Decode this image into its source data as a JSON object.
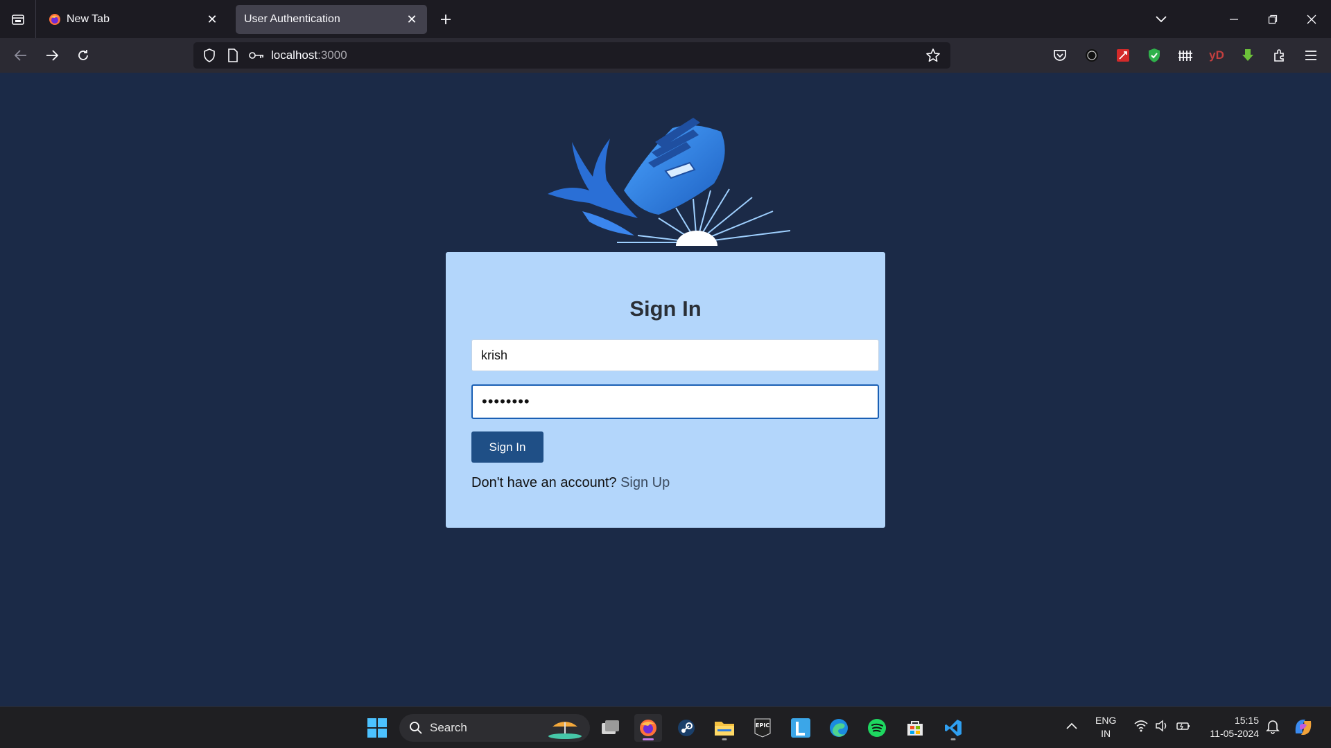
{
  "browser": {
    "tabs": [
      {
        "title": "New Tab",
        "active": false
      },
      {
        "title": "User Authentication",
        "active": true
      }
    ],
    "url_host": "localhost",
    "url_port": ":3000"
  },
  "page": {
    "heading": "Sign In",
    "username_value": "krish",
    "password_value": "••••••••",
    "signin_label": "Sign In",
    "signup_prompt": "Don't have an account?",
    "signup_link": "Sign Up"
  },
  "taskbar": {
    "search_label": "Search",
    "language_line1": "ENG",
    "language_line2": "IN",
    "time": "15:15",
    "date": "11-05-2024"
  },
  "colors": {
    "page_bg": "#1b2a47",
    "card_bg": "#b3d6fb",
    "button_bg": "#1f4f86",
    "focus_border": "#1a5fb4"
  }
}
